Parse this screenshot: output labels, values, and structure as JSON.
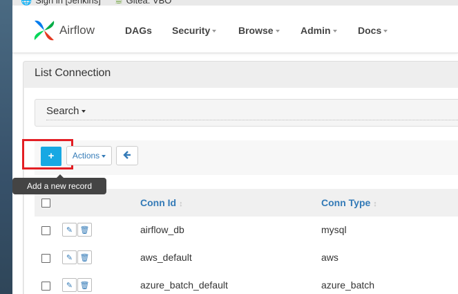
{
  "bookmarks": [
    {
      "label": "Sign in [Jenkins]",
      "icon": "globe-icon"
    },
    {
      "label": "Gitea: VBO",
      "icon": "gitea-icon"
    }
  ],
  "navbar": {
    "brand": "Airflow",
    "items": [
      {
        "label": "DAGs",
        "dropdown": false
      },
      {
        "label": "Security",
        "dropdown": true
      },
      {
        "label": "Browse",
        "dropdown": true
      },
      {
        "label": "Admin",
        "dropdown": true
      },
      {
        "label": "Docs",
        "dropdown": true
      }
    ]
  },
  "panel": {
    "title": "List Connection",
    "search_label": "Search"
  },
  "toolbar": {
    "add_label": "+",
    "actions_label": "Actions",
    "tooltip": "Add a new record"
  },
  "table": {
    "columns": [
      "Conn Id",
      "Conn Type"
    ],
    "rows": [
      {
        "conn_id": "airflow_db",
        "conn_type": "mysql"
      },
      {
        "conn_id": "aws_default",
        "conn_type": "aws"
      },
      {
        "conn_id": "azure_batch_default",
        "conn_type": "azure_batch"
      }
    ]
  },
  "colors": {
    "accent": "#17a8e3",
    "link": "#337ab7",
    "highlight": "#e31e24"
  }
}
